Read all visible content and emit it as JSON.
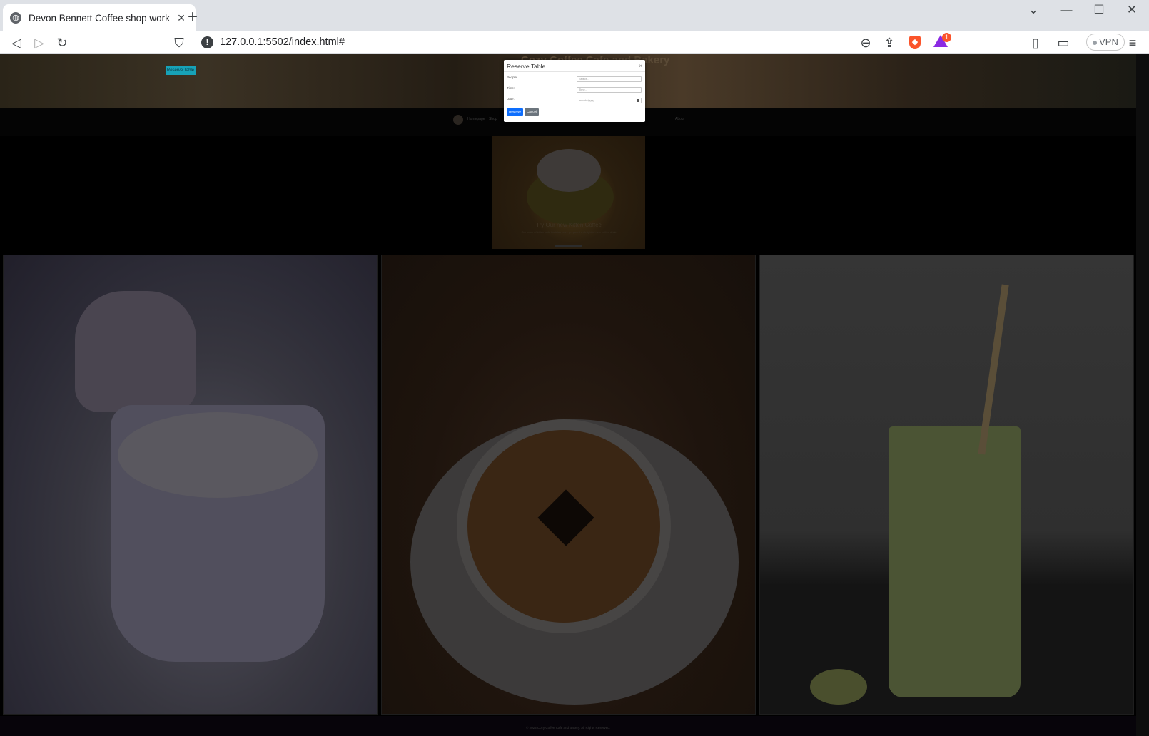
{
  "browser": {
    "tab_title": "Devon Bennett Coffee shop work",
    "url": "127.0.0.1:5502/index.html#",
    "rewards_badge": "1",
    "vpn_label": "VPN"
  },
  "page": {
    "site_title": "Cozy Coffee Cafe and Bakery",
    "hero_button": "Reserve Table",
    "nav_items": [
      "Homepage",
      "Shop",
      "About"
    ],
    "carousel_title": "Try Our new Kitten Coffee",
    "carousel_text": "Our team of kitten cafe baristas have prepared a delightful new coffee drink",
    "footer_text": "© 2023 Cozy Coffee Cafe and Bakery. All Rights Reserved."
  },
  "modal": {
    "title": "Reserve Table",
    "close": "×",
    "people_label": "People:",
    "people_placeholder": "Select...",
    "time_label": "Time:",
    "time_placeholder": "Time...",
    "date_label": "Date:",
    "date_placeholder": "mm/dd/yyyy",
    "reserve_label": "Reserve",
    "cancel_label": "Cancel"
  },
  "colors": {
    "overlay": "#000000",
    "reserve_button": "#0d6efd",
    "cancel_button": "#6c757d",
    "hero_button": "#17a2b8"
  }
}
